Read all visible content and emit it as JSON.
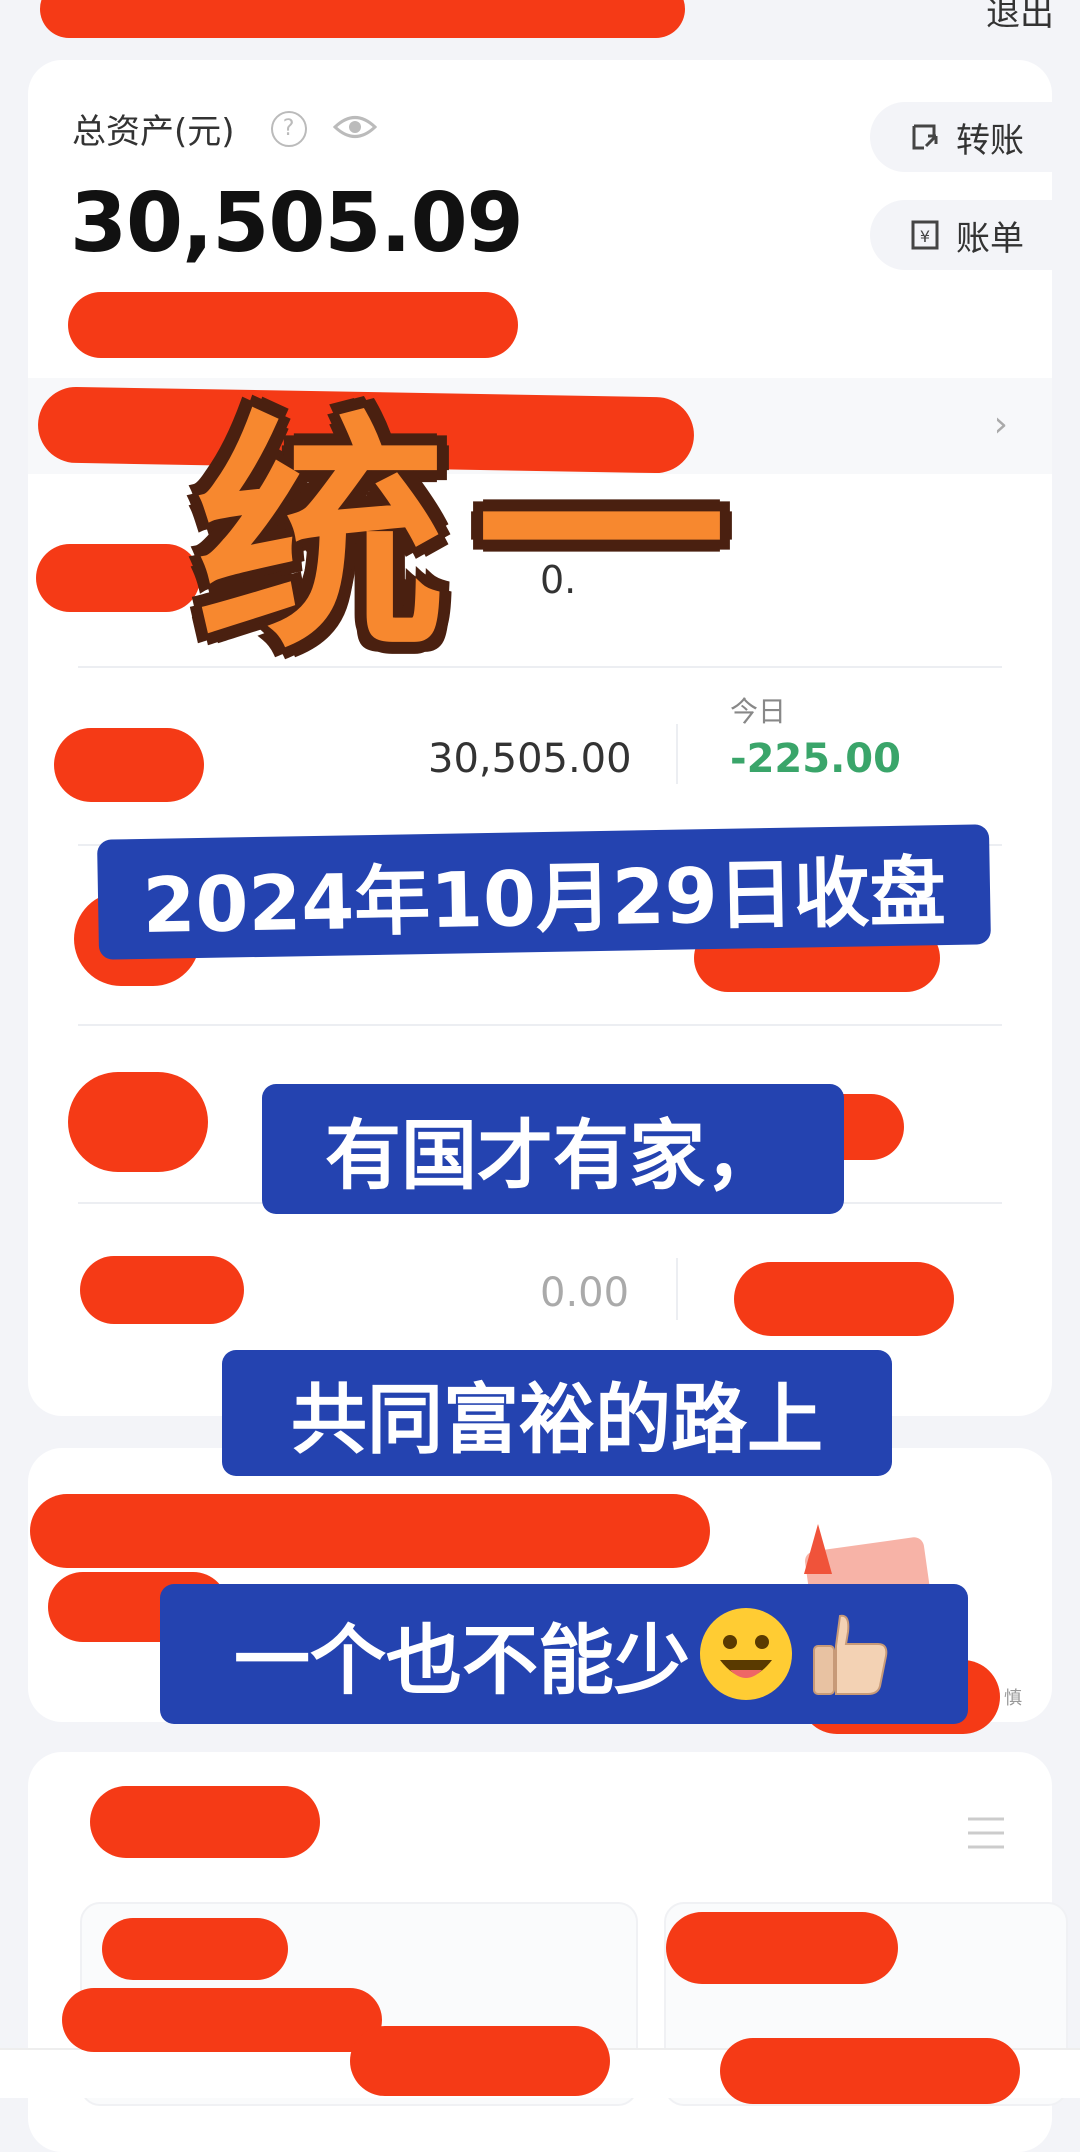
{
  "header": {
    "logout_label": "退出"
  },
  "assets": {
    "title": "总资产(元)",
    "total": "30,505.09",
    "transfer_label": "转账",
    "bill_label": "账单"
  },
  "rows": {
    "row1_value_partial": "0.",
    "row2_value": "30,505.00",
    "today_label": "今日",
    "today_value": "-225.00",
    "row4_value": "0.00"
  },
  "promo": {
    "fine_print": "慎"
  },
  "overlay": {
    "big_title": "统一",
    "date_banner": "2024年10月29日收盘",
    "line1": "有国才有家，",
    "line2": "共同富裕的路上",
    "line3": "一个也不能少"
  },
  "colors": {
    "accent_red": "#f53a16",
    "banner_blue": "#2443b0",
    "title_orange": "#f7882f",
    "negative_green": "#3aa56a"
  }
}
